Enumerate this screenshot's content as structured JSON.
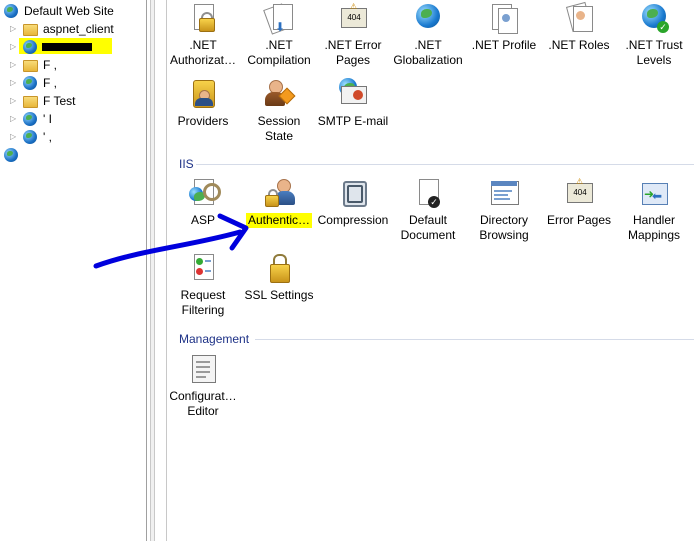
{
  "tree": {
    "items": [
      {
        "label": "Default Web Site",
        "icon": "globe-icon"
      },
      {
        "label": "aspnet_client",
        "icon": "folder-icon"
      },
      {
        "label": "",
        "icon": "globe-icon"
      },
      {
        "label": "",
        "icon": "folder-icon"
      },
      {
        "label": "",
        "icon": "globe-icon"
      },
      {
        "label": "",
        "icon": "folder-icon"
      },
      {
        "label": "",
        "icon": "globe-icon"
      },
      {
        "label": "",
        "icon": "globe-icon"
      },
      {
        "label": "",
        "icon": "globe-icon"
      }
    ],
    "partial": {
      "item3": "F   , ",
      "item4": "F   ,",
      "item5": "F Test",
      "item6": "' I",
      "item7": "' ,"
    }
  },
  "sections": {
    "aspnet_row1": [
      {
        "label": ".NET\nAuthorizat…",
        "icon": "lock-page-icon"
      },
      {
        "label": ".NET\nCompilation",
        "icon": "compilation-icon"
      },
      {
        "label": ".NET Error\nPages",
        "icon": "error-pages-icon"
      },
      {
        "label": ".NET\nGlobalization",
        "icon": "globe-icon"
      },
      {
        "label": ".NET Profile",
        "icon": "profile-icon"
      },
      {
        "label": ".NET Roles",
        "icon": "roles-icon"
      },
      {
        "label": ".NET Trust\nLevels",
        "icon": "trust-levels-icon"
      }
    ],
    "aspnet_row2": [
      {
        "label": "Providers",
        "icon": "providers-icon"
      },
      {
        "label": "Session State",
        "icon": "session-state-icon"
      },
      {
        "label": "SMTP E-mail",
        "icon": "smtp-email-icon"
      }
    ],
    "iis_title": "IIS",
    "iis_row1": [
      {
        "label": "ASP",
        "icon": "asp-icon"
      },
      {
        "label": "Authentic…",
        "icon": "authentication-icon"
      },
      {
        "label": "Compression",
        "icon": "compression-icon"
      },
      {
        "label": "Default\nDocument",
        "icon": "default-document-icon"
      },
      {
        "label": "Directory\nBrowsing",
        "icon": "directory-browsing-icon"
      },
      {
        "label": "Error Pages",
        "icon": "error-pages-icon"
      },
      {
        "label": "Handler\nMappings",
        "icon": "handler-mappings-icon"
      }
    ],
    "iis_row2": [
      {
        "label": "Request\nFiltering",
        "icon": "request-filtering-icon"
      },
      {
        "label": "SSL Settings",
        "icon": "ssl-settings-icon"
      }
    ],
    "management_title": "Management",
    "management_row": [
      {
        "label": "Configurat…\nEditor",
        "icon": "configuration-editor-icon"
      }
    ]
  },
  "colors": {
    "highlight": "#ffff00",
    "annotation_arrow": "#0000dd",
    "section_title": "#1e3287"
  }
}
